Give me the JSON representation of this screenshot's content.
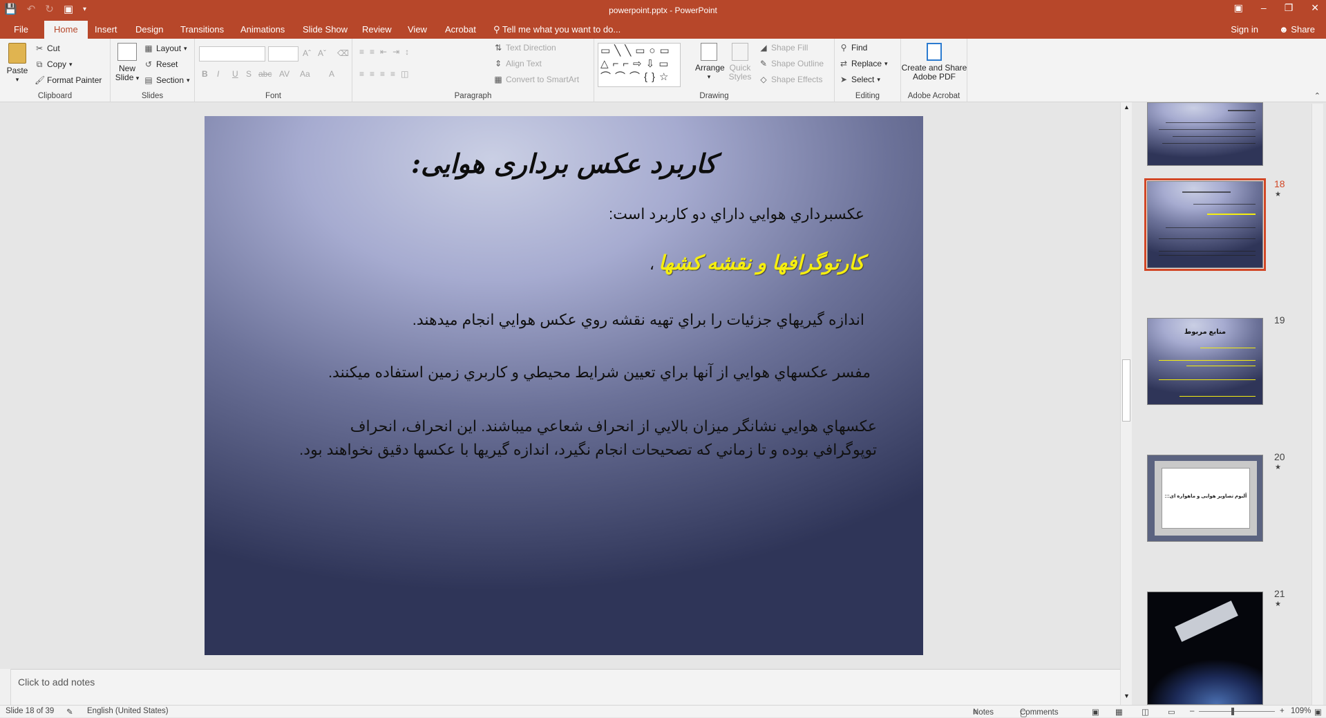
{
  "window": {
    "title": "powerpoint.pptx - PowerPoint",
    "sign_in": "Sign in",
    "share": "Share"
  },
  "tabs": [
    "File",
    "Home",
    "Insert",
    "Design",
    "Transitions",
    "Animations",
    "Slide Show",
    "Review",
    "View",
    "Acrobat"
  ],
  "tell_me": "Tell me what you want to do...",
  "ribbon": {
    "clipboard": {
      "label": "Clipboard",
      "paste": "Paste",
      "cut": "Cut",
      "copy": "Copy",
      "format_painter": "Format Painter"
    },
    "slides": {
      "label": "Slides",
      "new_slide_1": "New",
      "new_slide_2": "Slide",
      "layout": "Layout",
      "reset": "Reset",
      "section": "Section"
    },
    "font": {
      "label": "Font"
    },
    "paragraph": {
      "label": "Paragraph",
      "text_direction": "Text Direction",
      "align_text": "Align Text",
      "convert_smartart": "Convert to SmartArt"
    },
    "drawing": {
      "label": "Drawing",
      "arrange": "Arrange",
      "quick_styles_1": "Quick",
      "quick_styles_2": "Styles",
      "shape_fill": "Shape Fill",
      "shape_outline": "Shape Outline",
      "shape_effects": "Shape Effects"
    },
    "editing": {
      "label": "Editing",
      "find": "Find",
      "replace": "Replace",
      "select": "Select"
    },
    "acrobat": {
      "label": "Adobe Acrobat",
      "create_1": "Create and Share",
      "create_2": "Adobe PDF"
    }
  },
  "slide": {
    "title": "کاربرد عکس برداری هوایی:",
    "line1": "عكسبرداري هوايي داراي دو كاربرد است:",
    "highlight": "کارتوگرافها و نقشه کشها",
    "highlight_suffix": "،",
    "line2": "اندازه گيريهاي جزئيات را براي تهيه نقشه روي عكس هوايي انجام ميدهند.",
    "line3": "مفسر عكسهاي هوايي از آنها براي تعيين شرايط محيطي و كاربري زمين استفاده ميكنند.",
    "line4a": "عكسهاي هوايي نشانگر ميزان بالايي از انحراف شعاعي ميباشند. اين انحراف، انحراف",
    "line4b": "توپوگرافي بوده و تا زماني كه تصحيحات انجام نگيرد، اندازه گيريها با عكسها دقيق نخواهند بود."
  },
  "notes_placeholder": "Click to add notes",
  "thumbnails": [
    {
      "number": "",
      "star": false
    },
    {
      "number": "18",
      "star": true,
      "selected": true
    },
    {
      "number": "19",
      "star": false,
      "thumb_title": "منابع مربوط"
    },
    {
      "number": "20",
      "star": true,
      "thumb_title": "آلبوم تصاویر هوایی و ماهواره ای:::"
    },
    {
      "number": "21",
      "star": true
    }
  ],
  "status": {
    "slide_info": "Slide 18 of 39",
    "language": "English (United States)",
    "notes": "Notes",
    "comments": "Comments",
    "zoom": "109%"
  }
}
